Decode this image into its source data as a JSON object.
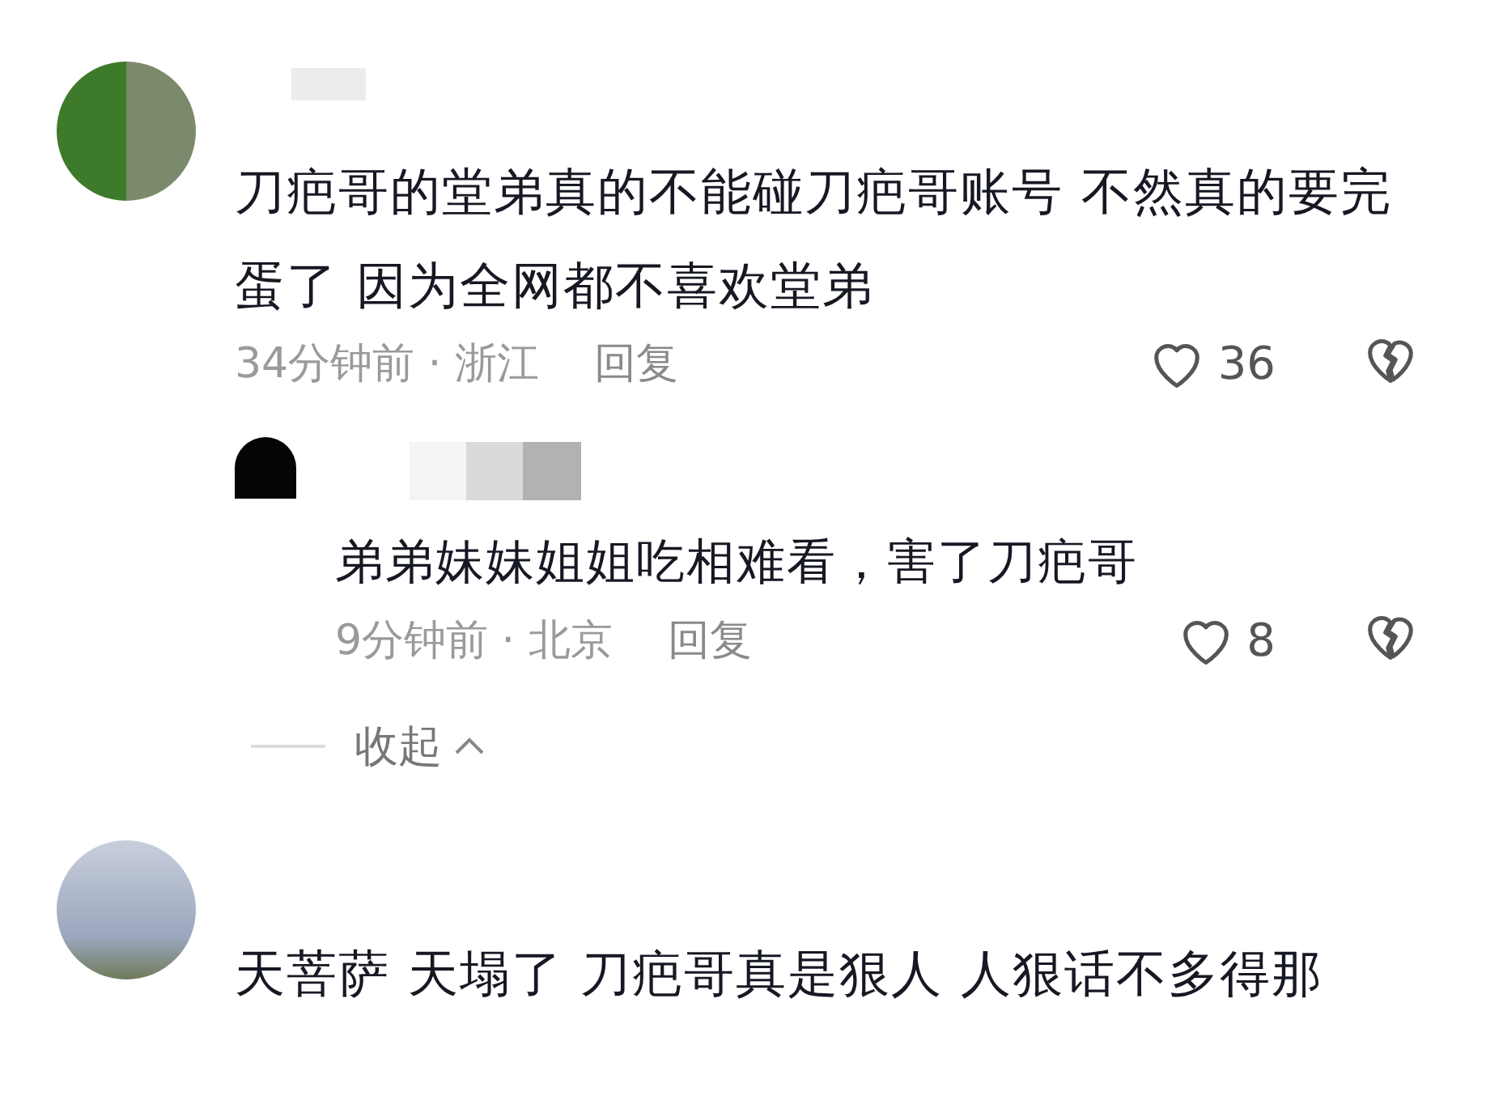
{
  "comments": [
    {
      "text": "刀疤哥的堂弟真的不能碰刀疤哥账号 不然真的要完蛋了 因为全网都不喜欢堂弟",
      "meta": "34分钟前 · 浙江",
      "reply_label": "回复",
      "likes": "36",
      "liked": false,
      "replies": [
        {
          "text": "弟弟妹妹姐姐吃相难看，害了刀疤哥",
          "meta": "9分钟前 · 北京",
          "reply_label": "回复",
          "likes": "8",
          "liked": false
        }
      ],
      "collapse_label": "收起"
    },
    {
      "text": "天菩萨 天塌了 刀疤哥真是狠人  人狠话不多得那"
    }
  ]
}
